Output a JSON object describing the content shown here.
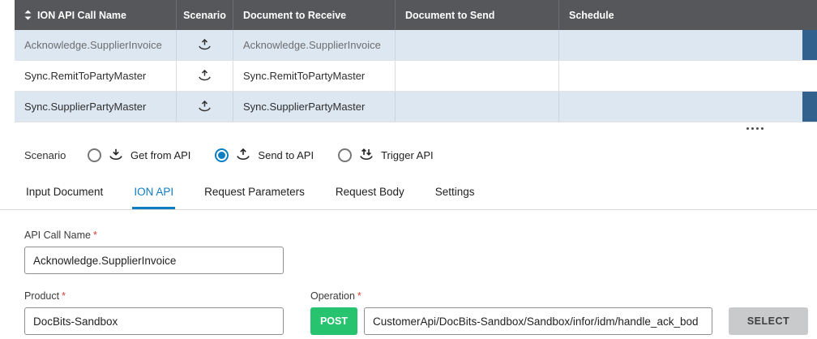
{
  "table": {
    "columns": [
      "ION API Call Name",
      "Scenario",
      "Document to Receive",
      "Document to Send",
      "Schedule"
    ],
    "rows": [
      {
        "api_call_name": "Acknowledge.SupplierInvoice",
        "scenario_icon": "send-to-api-icon",
        "document_to_receive": "Acknowledge.SupplierInvoice",
        "document_to_send": "",
        "schedule": ""
      },
      {
        "api_call_name": "Sync.RemitToPartyMaster",
        "scenario_icon": "send-to-api-icon",
        "document_to_receive": "Sync.RemitToPartyMaster",
        "document_to_send": "",
        "schedule": ""
      },
      {
        "api_call_name": "Sync.SupplierPartyMaster",
        "scenario_icon": "send-to-api-icon",
        "document_to_receive": "Sync.SupplierPartyMaster",
        "document_to_send": "",
        "schedule": ""
      }
    ]
  },
  "scenario": {
    "label": "Scenario",
    "options": [
      {
        "label": "Get from API",
        "icon": "get-from-api-icon",
        "selected": false
      },
      {
        "label": "Send to API",
        "icon": "send-to-api-icon",
        "selected": true
      },
      {
        "label": "Trigger API",
        "icon": "trigger-api-icon",
        "selected": false
      }
    ]
  },
  "tabs": [
    {
      "label": "Input Document",
      "active": false
    },
    {
      "label": "ION API",
      "active": true
    },
    {
      "label": "Request Parameters",
      "active": false
    },
    {
      "label": "Request Body",
      "active": false
    },
    {
      "label": "Settings",
      "active": false
    }
  ],
  "form": {
    "api_call_name": {
      "label": "API Call Name",
      "required_marker": "*",
      "value": "Acknowledge.SupplierInvoice"
    },
    "product": {
      "label": "Product",
      "required_marker": "*",
      "value": "DocBits-Sandbox"
    },
    "operation": {
      "label": "Operation",
      "required_marker": "*",
      "method": "POST",
      "endpoint": "CustomerApi/DocBits-Sandbox/Sandbox/infor/idm/handle_ack_bod",
      "select_button_label": "SELECT"
    }
  },
  "colors": {
    "table_header_bg": "#55575B",
    "row_highlight_bg": "#DDE7F2",
    "row_edge_accent": "#33618E",
    "accent_blue": "#0D7DC1",
    "post_green": "#27C36F",
    "select_button_bg": "#C9CACB",
    "required_red": "#CF3E36"
  }
}
